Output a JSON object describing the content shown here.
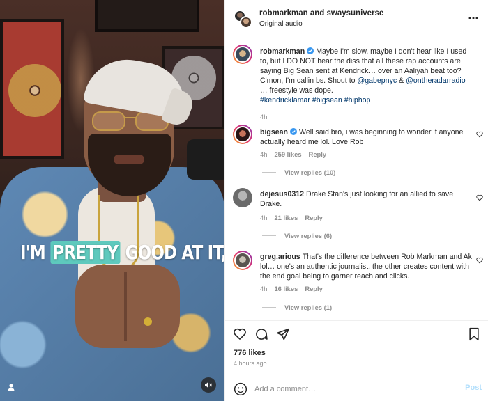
{
  "video": {
    "caption_pre": "I'M ",
    "caption_highlight": "PRETTY",
    "caption_post": " GOOD AT IT,",
    "icons": {
      "tag": "user-tag-icon",
      "audio": "muted-speaker-icon"
    }
  },
  "header": {
    "names": "robmarkman and swaysuniverse",
    "audio": "Original audio",
    "more_icon": "more-options-icon"
  },
  "post_caption": {
    "username": "robmarkman",
    "text_a": "Maybe I'm slow, maybe I don't hear like I used to, but I DO NOT hear the diss that all these rap accounts are saying Big Sean sent at Kendrick… over an Aaliyah beat too? C'mon, I'm callin bs. Shout to ",
    "mention1": "@gabepnyc",
    "text_b": " & ",
    "mention2": "@ontheradarradio",
    "text_c": " … freestyle was dope.",
    "hashtags": "#kendricklamar #bigsean #hiphop",
    "time": "4h"
  },
  "comments": [
    {
      "username": "bigsean",
      "verified": true,
      "text": "Well said bro, i was beginning to wonder if anyone actually heard me lol. Love Rob",
      "time": "4h",
      "likes": "259 likes",
      "reply": "Reply",
      "view_replies": "View replies (10)"
    },
    {
      "username": "dejesus0312",
      "verified": false,
      "text": "Drake Stan's just looking for an allied to save Drake.",
      "time": "4h",
      "likes": "21 likes",
      "reply": "Reply",
      "view_replies": "View replies (6)"
    },
    {
      "username": "greg.arious",
      "verified": false,
      "text": "That's the difference between Rob Markman and Ak lol… one's an authentic journalist, the other creates content with the end goal being to garner reach and clicks.",
      "time": "4h",
      "likes": "16 likes",
      "reply": "Reply",
      "view_replies": "View replies (1)"
    }
  ],
  "actions": {
    "icons": [
      "heart-icon",
      "comment-icon",
      "share-icon",
      "bookmark-icon"
    ],
    "likes": "776 likes",
    "posted": "4 hours ago"
  },
  "composer": {
    "emoji_icon": "emoji-icon",
    "placeholder": "Add a comment…",
    "value": "",
    "post_label": "Post"
  },
  "colors": {
    "verified": "#3897f0",
    "link": "#00376b",
    "muted": "#8e8e8e",
    "post_disabled": "#b2dffc",
    "caption_highlight": "#5ec9bd"
  }
}
